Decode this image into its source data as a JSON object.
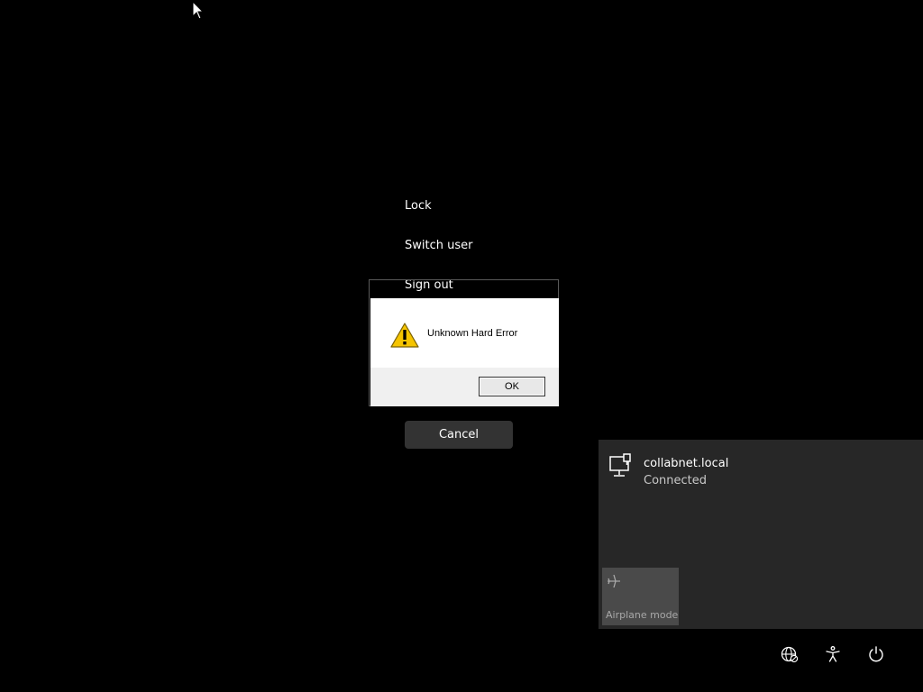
{
  "power_menu": {
    "lock_label": "Lock",
    "switch_user_label": "Switch user",
    "sign_out_label": "Sign out",
    "cancel_label": "Cancel"
  },
  "error_dialog": {
    "message": "Unknown Hard Error",
    "ok_label": "OK",
    "icon": "warning-icon"
  },
  "network_flyout": {
    "network_name": "collabnet.local",
    "network_status": "Connected",
    "network_icon": "ethernet-icon",
    "airplane_mode_label": "Airplane mode",
    "airplane_icon": "airplane-icon"
  },
  "system_icons": [
    "network-globe-icon",
    "accessibility-icon",
    "power-icon"
  ],
  "colors": {
    "background": "#000000",
    "flyout_bg": "#272727",
    "tile_bg": "#4a4a4a",
    "cancel_bg": "#333333",
    "warning_yellow": "#f5c400"
  }
}
